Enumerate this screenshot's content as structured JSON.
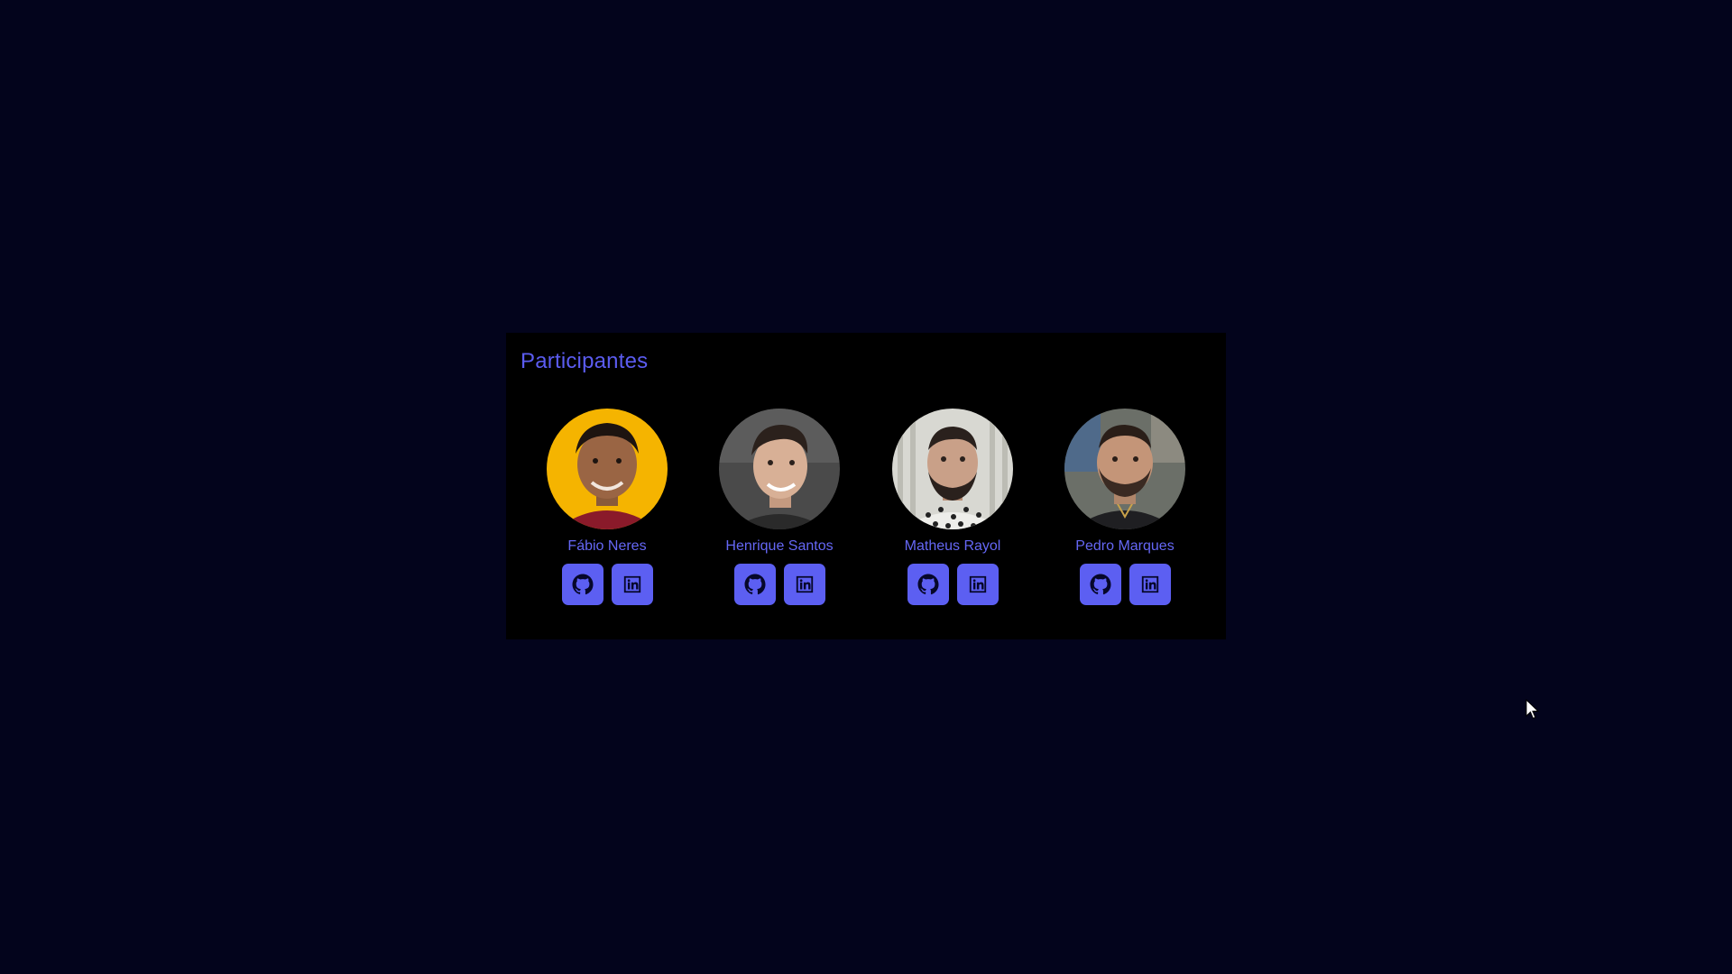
{
  "section": {
    "title": "Participantes"
  },
  "participants": [
    {
      "name": "Fábio Neres",
      "avatar_bg": "#f5b400"
    },
    {
      "name": "Henrique Santos",
      "avatar_bg": "#4a4a4a"
    },
    {
      "name": "Matheus Rayol",
      "avatar_bg": "#d8d8d2"
    },
    {
      "name": "Pedro Marques",
      "avatar_bg": "#6b6f68"
    }
  ],
  "links": [
    "github-icon",
    "linkedin-icon"
  ],
  "colors": {
    "page_background": "#03041c",
    "card_background": "#000000",
    "accent": "#5c5ff2",
    "text_accent": "#6567f5"
  }
}
